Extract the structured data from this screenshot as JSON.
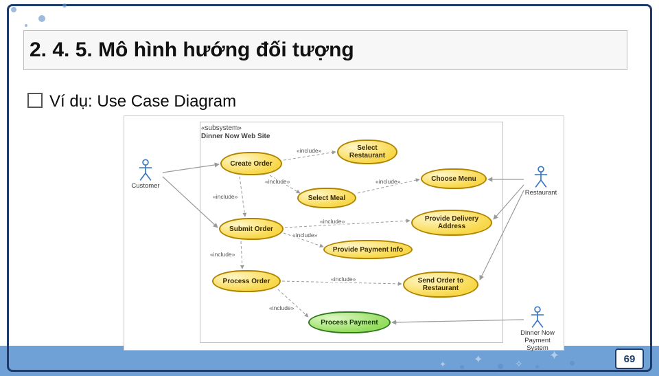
{
  "title": "2. 4. 5. Mô hình hướng đối tượng",
  "bullet": "Ví dụ: Use Case Diagram",
  "page_number": "69",
  "subsystem": {
    "stereotype": "«subsystem»",
    "name": "Dinner Now Web Site"
  },
  "actors": {
    "customer": "Customer",
    "restaurant": "Restaurant",
    "payment": "Dinner Now\nPayment System"
  },
  "usecases": {
    "create_order": "Create Order",
    "select_restaurant": "Select\nRestaurant",
    "select_meal": "Select Meal",
    "submit_order": "Submit Order",
    "choose_menu": "Choose Menu",
    "provide_payment": "Provide Payment Info",
    "provide_delivery": "Provide Delivery\nAddress",
    "process_order": "Process Order",
    "send_order": "Send Order to\nRestaurant",
    "process_payment": "Process Payment"
  },
  "edge_label": "«include»"
}
